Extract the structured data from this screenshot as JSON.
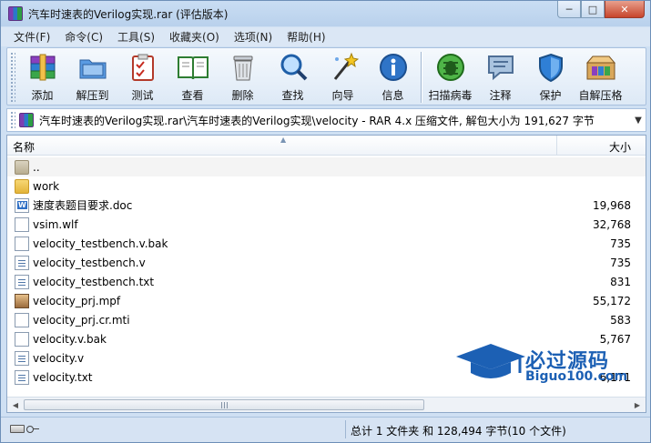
{
  "window": {
    "title": "汽车时速表的Verilog实现.rar (评估版本)"
  },
  "menu": [
    "文件(F)",
    "命令(C)",
    "工具(S)",
    "收藏夹(O)",
    "选项(N)",
    "帮助(H)"
  ],
  "toolbar": {
    "add": "添加",
    "extract": "解压到",
    "test": "测试",
    "view": "查看",
    "delete": "删除",
    "find": "查找",
    "wizard": "向导",
    "info": "信息",
    "scan": "扫描病毒",
    "comment": "注释",
    "protect": "保护",
    "sfx": "自解压格"
  },
  "address": {
    "path": "汽车时速表的Verilog实现.rar\\汽车时速表的Verilog实现\\velocity - RAR 4.x 压缩文件, 解包大小为 191,627 字节"
  },
  "columns": {
    "name": "名称",
    "size": "大小"
  },
  "files": [
    {
      "name": "..",
      "size": "",
      "icon": "folder-up-icon"
    },
    {
      "name": "work",
      "size": "",
      "icon": "folder-icon"
    },
    {
      "name": "速度表题目要求.doc",
      "size": "19,968",
      "icon": "word-document-icon"
    },
    {
      "name": "vsim.wlf",
      "size": "32,768",
      "icon": "file-icon"
    },
    {
      "name": "velocity_testbench.v.bak",
      "size": "735",
      "icon": "file-icon"
    },
    {
      "name": "velocity_testbench.v",
      "size": "735",
      "icon": "text-file-icon"
    },
    {
      "name": "velocity_testbench.txt",
      "size": "831",
      "icon": "text-file-icon"
    },
    {
      "name": "velocity_prj.mpf",
      "size": "55,172",
      "icon": "project-file-icon"
    },
    {
      "name": "velocity_prj.cr.mti",
      "size": "583",
      "icon": "file-icon"
    },
    {
      "name": "velocity.v.bak",
      "size": "5,767",
      "icon": "file-icon"
    },
    {
      "name": "velocity.v",
      "size": "",
      "icon": "text-file-icon"
    },
    {
      "name": "velocity.txt",
      "size": "6,171",
      "icon": "text-file-icon"
    }
  ],
  "status": {
    "summary": "总计 1 文件夹 和 128,494 字节(10 个文件)"
  },
  "watermark": {
    "title": "必过源码",
    "site": "Biguo100.com"
  }
}
